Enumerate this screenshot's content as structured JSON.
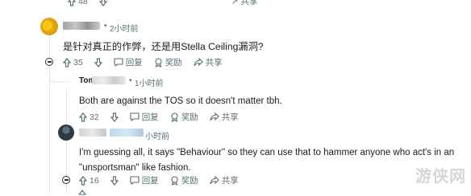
{
  "top_actions": {
    "count": "48",
    "share": "共享"
  },
  "comment1": {
    "time": "2小时前",
    "text": "是针对真正的作弊，还是用Stella Ceiling漏洞?",
    "votes": "35",
    "reply": "回复",
    "award": "奖励",
    "share": "共享"
  },
  "comment2": {
    "username": "Tom",
    "time": "1小时前",
    "text": "Both are against the TOS so it doesn't matter tbh.",
    "votes": "32",
    "reply": "回复",
    "award": "奖励",
    "share": "共享"
  },
  "comment3": {
    "time": "小时前",
    "text_line1": "I'm guessing all, it says \"Behaviour\" so they can use that to hammer anyone who act's in an",
    "text_line2": "\"unsportsman\" like fashion.",
    "votes": "16",
    "reply": "回复",
    "award": "奖励",
    "share": "共享"
  },
  "watermark": "游侠网",
  "colors": {
    "meta": "#576f76",
    "text": "#1c1c1c",
    "line": "#e4e6e8"
  }
}
